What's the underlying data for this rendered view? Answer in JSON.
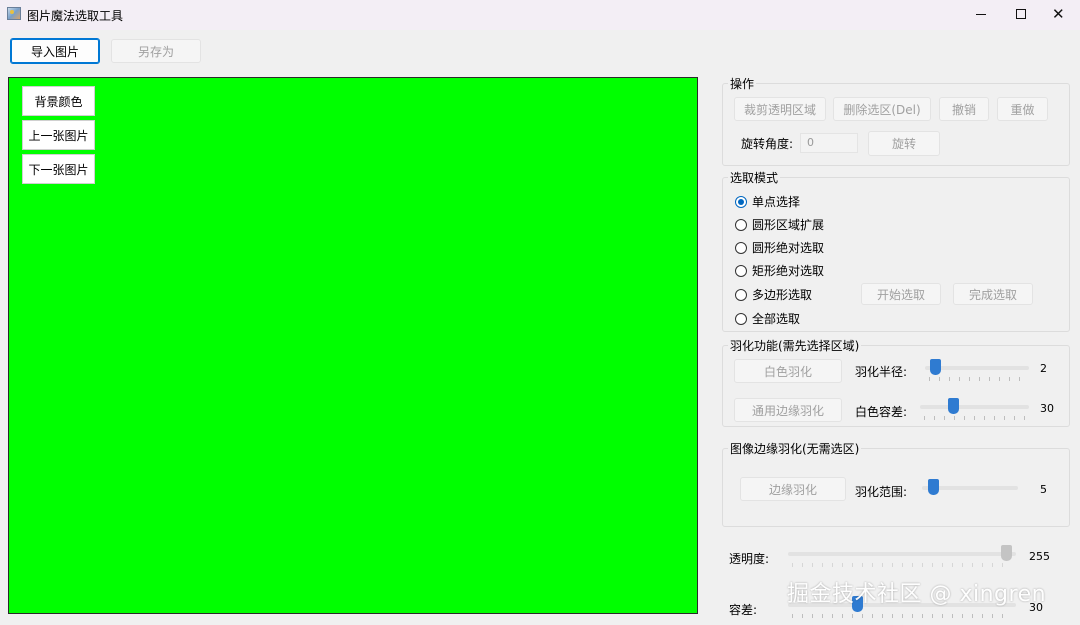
{
  "window": {
    "title": "图片魔法选取工具",
    "min_glyph": "—",
    "close_glyph": "✕"
  },
  "toolbar": {
    "import_label": "导入图片",
    "save_as_label": "另存为"
  },
  "canvas": {
    "background_color": "#00ff00",
    "bg_color_label": "背景颜色",
    "prev_label": "上一张图片",
    "next_label": "下一张图片"
  },
  "operations": {
    "title": "操作",
    "crop_label": "裁剪透明区域",
    "delete_label": "删除选区(Del)",
    "undo_label": "撤销",
    "redo_label": "重做",
    "rotate_angle_label": "旋转角度:",
    "rotate_angle_value": "0",
    "rotate_label": "旋转"
  },
  "selection_mode": {
    "title": "选取模式",
    "options": [
      {
        "label": "单点选择",
        "checked": true
      },
      {
        "label": "圆形区域扩展",
        "checked": false
      },
      {
        "label": "圆形绝对选取",
        "checked": false
      },
      {
        "label": "矩形绝对选取",
        "checked": false
      },
      {
        "label": "多边形选取",
        "checked": false
      },
      {
        "label": "全部选取",
        "checked": false
      }
    ],
    "start_label": "开始选取",
    "finish_label": "完成选取"
  },
  "feather": {
    "title": "羽化功能(需先选择区域)",
    "white_feather_label": "白色羽化",
    "radius_label": "羽化半径:",
    "radius_value": "2",
    "edge_feather_label": "通用边缘羽化",
    "white_tolerance_label": "白色容差:",
    "white_tolerance_value": "30"
  },
  "edge_feather": {
    "title": "图像边缘羽化(无需选区)",
    "button_label": "边缘羽化",
    "range_label": "羽化范围:",
    "range_value": "5"
  },
  "opacity": {
    "label": "透明度:",
    "value": "255"
  },
  "tolerance": {
    "label": "容差:",
    "value": "30"
  },
  "watermark": "掘金技术社区 @ xingren"
}
